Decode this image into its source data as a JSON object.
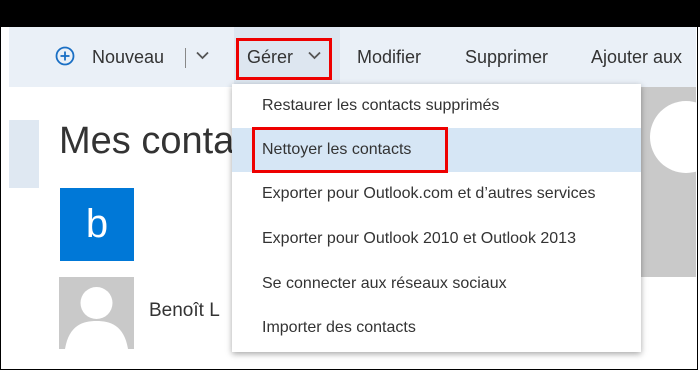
{
  "toolbar": {
    "new_label": "Nouveau",
    "manage_label": "Gérer",
    "edit_label": "Modifier",
    "delete_label": "Supprimer",
    "add_label": "Ajouter aux"
  },
  "page": {
    "title": "Mes conta"
  },
  "contacts": {
    "group_letter": "b",
    "contact_name": "Benoît L"
  },
  "manage_menu": {
    "items": [
      {
        "label": "Restaurer les contacts supprimés"
      },
      {
        "label": "Nettoyer les contacts"
      },
      {
        "label": "Exporter pour Outlook.com et d’autres services"
      },
      {
        "label": "Exporter pour Outlook 2010 et Outlook 2013"
      },
      {
        "label": "Se connecter aux réseaux sociaux"
      },
      {
        "label": "Importer des contacts"
      }
    ],
    "highlighted_item": "Nettoyer les contacts"
  },
  "colors": {
    "accent": "#0078d7",
    "highlight_box": "#e00000",
    "hover": "#d6e6f5"
  }
}
